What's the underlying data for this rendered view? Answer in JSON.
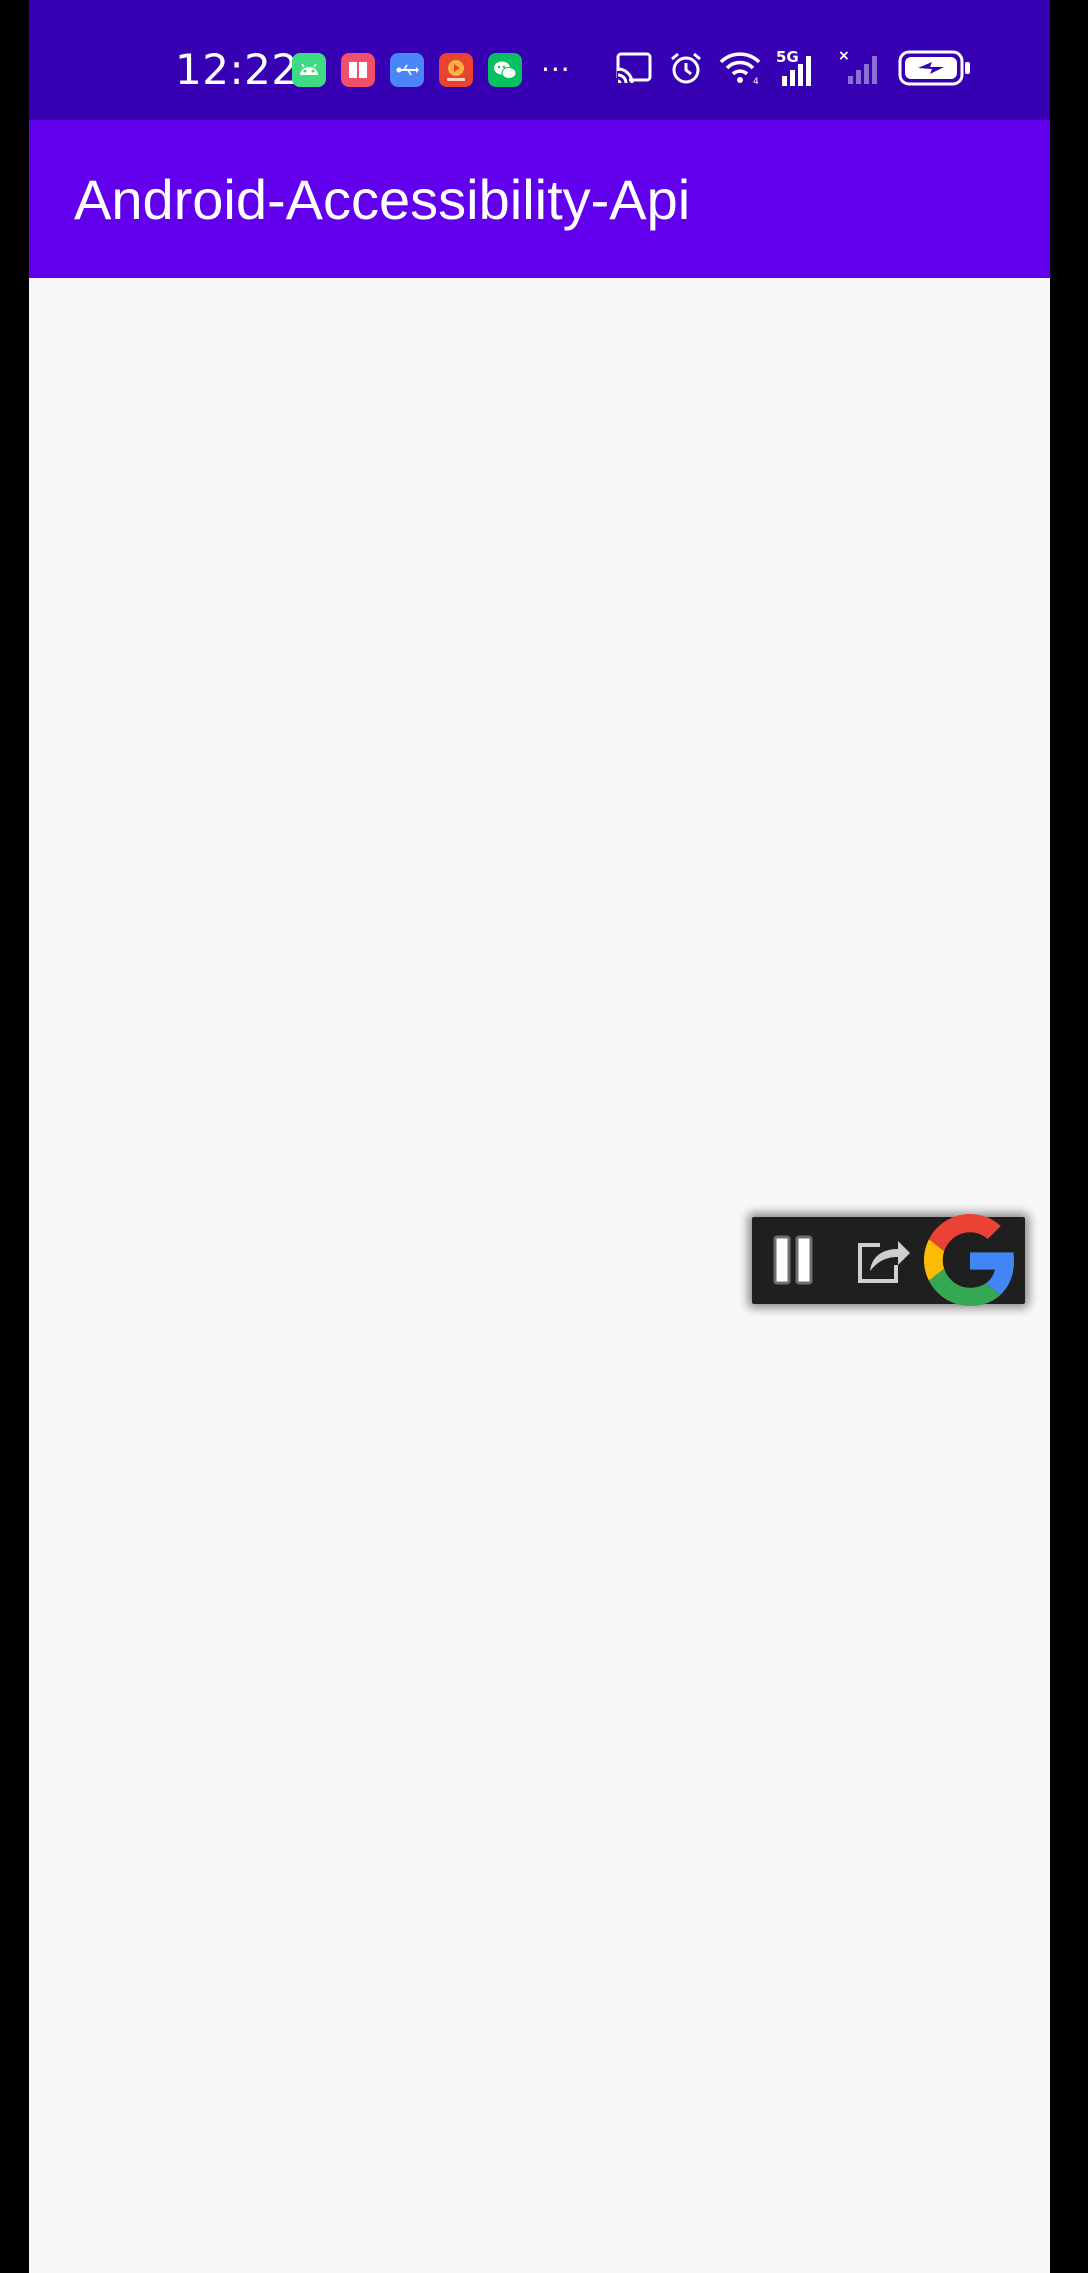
{
  "status_bar": {
    "time": "12:22",
    "more_indicator": "···",
    "notification_icons": [
      "android-studio-icon",
      "book-app-icon",
      "usb-debug-icon",
      "video-app-icon",
      "wechat-icon"
    ],
    "system_icons": [
      "cast-icon",
      "alarm-icon",
      "wifi-icon",
      "5g-signal-icon",
      "no-signal-icon",
      "battery-charging-icon"
    ],
    "signal_label": "5G",
    "colors": {
      "background": "#3700b3",
      "foreground": "#ffffff"
    }
  },
  "app_bar": {
    "title": "Android-Accessibility-Api",
    "background": "#6200ee"
  },
  "content": {
    "background": "#f8f8f8"
  },
  "floating_toolbar": {
    "buttons": [
      "pause-icon",
      "share-icon",
      "google-icon"
    ],
    "background": "#1f1f1f"
  }
}
